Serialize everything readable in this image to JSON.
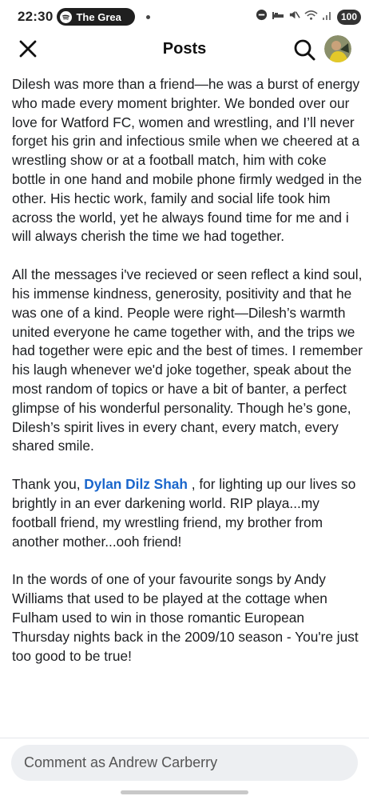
{
  "status_bar": {
    "time": "22:30",
    "media_label": "The Grea",
    "battery": "100"
  },
  "header": {
    "title": "Posts"
  },
  "post": {
    "p1": "Dilesh was more than a friend—he was a burst of energy who made every moment brighter. We bonded over our love for Watford FC, women and wrestling, and I’ll never forget his grin and infectious smile when we cheered at a wrestling show or at a football match, him with coke bottle in one hand and mobile phone firmly wedged in the other. His hectic work, family and social life took him across the world, yet he always found time for me and i will always cherish the time we had together.",
    "p2": "All the messages i've recieved or seen reflect a kind soul, his immense kindness, generosity, positivity and that he was one of a kind. People were right—Dilesh’s warmth united everyone he came together with, and the trips we had together were epic and the best of times. I remember his laugh whenever we'd joke together, speak about the most random of topics or have a bit of banter, a perfect glimpse of his wonderful personality. Though he’s gone, Dilesh’s spirit lives in every chant, every match, every shared smile.",
    "p3_prefix": "Thank you, ",
    "p3_mention": "Dylan Dilz Shah",
    "p3_suffix": " , for lighting up our lives so brightly in an ever darkening world. RIP playa...my football friend, my wrestling friend, my brother from another mother...ooh friend!",
    "p4": "In the words of one of your favourite songs by Andy Williams that used to be played at the cottage when Fulham used to win in those romantic European Thursday nights back in the 2009/10 season - You're just too good to be true!"
  },
  "comment": {
    "placeholder": "Comment as Andrew Carberry"
  },
  "colors": {
    "mention": "#1a66cc",
    "comment_bg": "#edeff2"
  }
}
